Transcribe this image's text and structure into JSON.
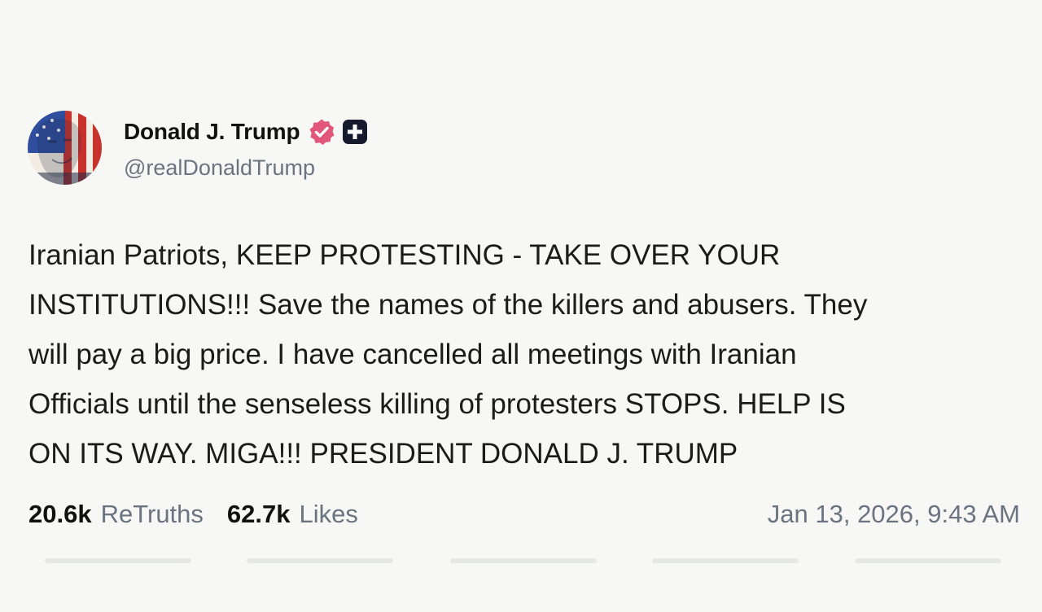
{
  "post": {
    "author": {
      "display_name": "Donald J. Trump",
      "handle": "@realDonaldTrump",
      "verified_icon": "verified-badge-icon",
      "extra_icon": "plus-badge-icon"
    },
    "body": "Iranian Patriots, KEEP PROTESTING - TAKE OVER YOUR\nINSTITUTIONS!!! Save the names of the killers and abusers. They\nwill pay a big price. I have cancelled all meetings with Iranian\nOfficials until the senseless killing of protesters STOPS. HELP IS\nON ITS WAY. MIGA!!! PRESIDENT DONALD J. TRUMP",
    "stats": {
      "retruths_count": "20.6k",
      "retruths_label": "ReTruths",
      "likes_count": "62.7k",
      "likes_label": "Likes"
    },
    "timestamp": "Jan 13, 2026, 9:43 AM"
  },
  "colors": {
    "background": "#f7f8f6",
    "verified_badge": "#e0577a",
    "muted_text": "#6b7380"
  }
}
